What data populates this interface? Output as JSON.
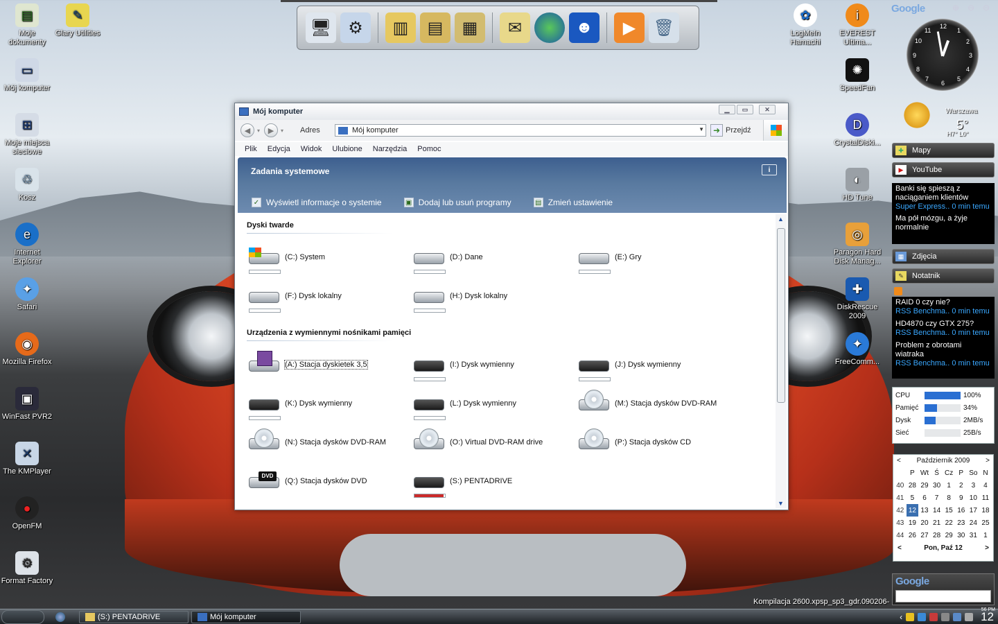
{
  "desktop": {
    "left_icons": [
      {
        "label": "Moje dokumenty",
        "icon": "documents-icon"
      },
      {
        "label": "Mój komputer",
        "icon": "computer-icon"
      },
      {
        "label": "Moje miejsca sieciowe",
        "icon": "network-icon"
      },
      {
        "label": "Kosz",
        "icon": "recycle-bin-icon"
      },
      {
        "label": "Internet Explorer",
        "icon": "ie-icon"
      },
      {
        "label": "Safari",
        "icon": "safari-icon"
      },
      {
        "label": "Mozilla Firefox",
        "icon": "firefox-icon"
      },
      {
        "label": "WinFast PVR2",
        "icon": "pvr-icon"
      },
      {
        "label": "The KMPlayer",
        "icon": "kmplayer-icon"
      },
      {
        "label": "OpenFM",
        "icon": "openfm-icon"
      },
      {
        "label": "Format Factory",
        "icon": "format-factory-icon"
      }
    ],
    "second_column_icon": {
      "label": "Glary Utilities",
      "icon": "glary-icon"
    },
    "right_icons": [
      {
        "label": "LogMeIn Hamachi",
        "icon": "hamachi-icon"
      },
      {
        "label": "EVEREST Ultima...",
        "icon": "everest-icon"
      },
      {
        "label": "SpeedFan",
        "icon": "speedfan-icon"
      },
      {
        "label": "CrystalDiski...",
        "icon": "crystaldisk-icon"
      },
      {
        "label": "HD Tune",
        "icon": "hdtune-icon"
      },
      {
        "label": "Paragon Hard Disk Manag...",
        "icon": "paragon-icon"
      },
      {
        "label": "DiskRescue 2009",
        "icon": "diskrescue-icon"
      },
      {
        "label": "FreeComm...",
        "icon": "freecomm-icon"
      }
    ],
    "build_text": "Kompilacja 2600.xpsp_sp3_gdr.090206-"
  },
  "dock": {
    "items": [
      "monitor-icon",
      "network-settings-icon",
      "folder-icon",
      "documents-icon",
      "pictures-icon",
      "mail-icon",
      "globe-icon",
      "messenger-icon",
      "media-player-icon",
      "trash-icon"
    ]
  },
  "window": {
    "title": "Mój komputer",
    "address_label": "Adres",
    "address_value": "Mój komputer",
    "go_label": "Przejdź",
    "menu": [
      "Plik",
      "Edycja",
      "Widok",
      "Ulubione",
      "Narzędzia",
      "Pomoc"
    ],
    "tasks_header": "Zadania systemowe",
    "info_label": "i",
    "tasks": [
      "Wyświetl informacje o systemie",
      "Dodaj lub usuń programy",
      "Zmień ustawienie"
    ],
    "sections": {
      "hard_drives": "Dyski twarde",
      "removable": "Urządzenia z wymiennymi nośnikami pamięci"
    },
    "hard_drives": [
      {
        "label": "(C:) System",
        "kind": "system",
        "used": 0.0
      },
      {
        "label": "(D:) Dane",
        "kind": "hdd",
        "used": 0.0
      },
      {
        "label": "(E:) Gry",
        "kind": "hdd",
        "used": 0.0
      },
      {
        "label": "(F:) Dysk lokalny",
        "kind": "hdd",
        "used": 0.0
      },
      {
        "label": "(H:) Dysk lokalny",
        "kind": "hdd",
        "used": 0.0
      }
    ],
    "removable": [
      {
        "label": "(A:) Stacja dyskietek 3,5",
        "kind": "floppy"
      },
      {
        "label": "(I:) Dysk wymienny",
        "kind": "removable",
        "used": 0.0
      },
      {
        "label": "(J:) Dysk wymienny",
        "kind": "removable",
        "used": 0.0
      },
      {
        "label": "(K:) Dysk wymienny",
        "kind": "removable",
        "used": 0.0
      },
      {
        "label": "(L:) Dysk wymienny",
        "kind": "removable",
        "used": 0.0
      },
      {
        "label": "(M:) Stacja dysków DVD-RAM",
        "kind": "optical"
      },
      {
        "label": "(N:) Stacja dysków DVD-RAM",
        "kind": "optical"
      },
      {
        "label": "(O:) Virtual DVD-RAM drive",
        "kind": "optical"
      },
      {
        "label": "(P:) Stacja dysków CD",
        "kind": "optical"
      },
      {
        "label": "(Q:) Stacja dysków DVD",
        "kind": "dvd",
        "badge": "DVD"
      },
      {
        "label": "(S:) PENTADRIVE",
        "kind": "removable",
        "used": 0.95
      }
    ]
  },
  "sidebar": {
    "google_label": "Google",
    "clock_numbers": [
      "12",
      "1",
      "2",
      "3",
      "4",
      "5",
      "6",
      "7",
      "8",
      "9",
      "10",
      "11"
    ],
    "weather": {
      "city": "Warszawa",
      "temp": "5°",
      "range": "H7° L0°"
    },
    "buttons": {
      "maps": "Mapy",
      "youtube": "YouTube",
      "photos": "Zdjęcia",
      "notes": "Notatnik"
    },
    "news": [
      {
        "title": "Banki się spieszą z naciąganiem klientów",
        "source": "Super Express..",
        "time": "0 min temu"
      },
      {
        "title": "Ma pół mózgu, a żyje normalnie",
        "source": "",
        "time": ""
      }
    ],
    "rss": [
      {
        "title": "RAID 0 czy nie?",
        "source": "RSS Benchma..",
        "time": "0 min temu"
      },
      {
        "title": "HD4870 czy GTX 275?",
        "source": "RSS Benchma..",
        "time": "0 min temu"
      },
      {
        "title": "Problem z obrotami wiatraka",
        "source": "RSS Benchma..",
        "time": "0 min temu"
      }
    ],
    "meters": [
      {
        "label": "CPU",
        "value": "100%",
        "fill": 1.0
      },
      {
        "label": "Pamięć",
        "value": "34%",
        "fill": 0.34
      },
      {
        "label": "Dysk",
        "value": "2MB/s",
        "fill": 0.3
      },
      {
        "label": "Sieć",
        "value": "25B/s",
        "fill": 0.0
      }
    ],
    "calendar": {
      "month": "Październik 2009",
      "days": [
        "P",
        "Wt",
        "Ś",
        "Cz",
        "P",
        "So",
        "N"
      ],
      "weeks": [
        [
          "40",
          "28",
          "29",
          "30",
          "1",
          "2",
          "3",
          "4"
        ],
        [
          "41",
          "5",
          "6",
          "7",
          "8",
          "9",
          "10",
          "11"
        ],
        [
          "42",
          "12",
          "13",
          "14",
          "15",
          "16",
          "17",
          "18"
        ],
        [
          "43",
          "19",
          "20",
          "21",
          "22",
          "23",
          "24",
          "25"
        ],
        [
          "44",
          "26",
          "27",
          "28",
          "29",
          "30",
          "31",
          "1"
        ]
      ],
      "today_label": "Pon, Paź 12",
      "prev": "<",
      "next": ">"
    },
    "google_search_label": "Google"
  },
  "taskbar": {
    "buttons": [
      {
        "label": "(S:) PENTADRIVE",
        "icon": "folder-icon"
      },
      {
        "label": "Mój komputer",
        "icon": "computer-icon"
      }
    ],
    "clock": "12",
    "clock_small": "56 PM"
  }
}
